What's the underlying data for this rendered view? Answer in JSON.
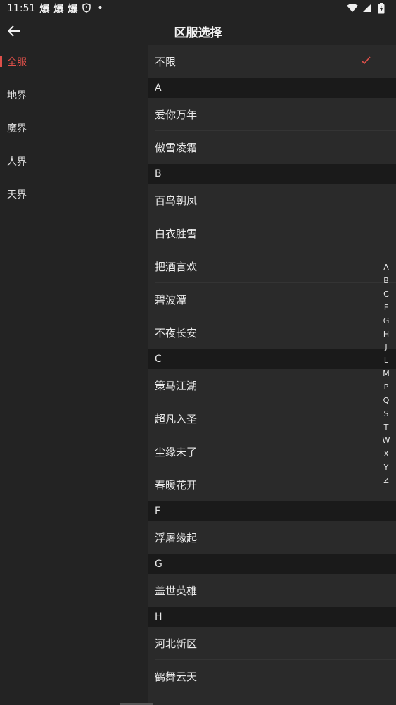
{
  "status": {
    "time": "11:51",
    "notification_icons": [
      "爆",
      "爆",
      "爆"
    ],
    "dot": "•"
  },
  "appbar": {
    "title": "区服选择"
  },
  "sidebar": {
    "items": [
      {
        "label": "全服",
        "active": true
      },
      {
        "label": "地界"
      },
      {
        "label": "魔界"
      },
      {
        "label": "人界"
      },
      {
        "label": "天界"
      }
    ]
  },
  "list": {
    "unlimited": "不限",
    "sections": [
      {
        "letter": "A",
        "items": [
          "爱你万年",
          "傲雪凌霜"
        ]
      },
      {
        "letter": "B",
        "items": [
          "百鸟朝凤",
          "白衣胜雪",
          "把酒言欢",
          "碧波潭",
          "不夜长安"
        ]
      },
      {
        "letter": "C",
        "items": [
          "策马江湖",
          "超凡入圣",
          "尘缘未了",
          "春暖花开"
        ]
      },
      {
        "letter": "F",
        "items": [
          "浮屠缘起"
        ]
      },
      {
        "letter": "G",
        "items": [
          "盖世英雄"
        ]
      },
      {
        "letter": "H",
        "items": [
          "河北新区",
          "鹤舞云天"
        ]
      }
    ]
  },
  "index_letters": [
    "A",
    "B",
    "C",
    "F",
    "G",
    "H",
    "J",
    "L",
    "M",
    "P",
    "Q",
    "S",
    "T",
    "W",
    "X",
    "Y",
    "Z"
  ],
  "colors": {
    "accent": "#e0504a",
    "background": "#232323",
    "header": "#1a1a1a"
  }
}
